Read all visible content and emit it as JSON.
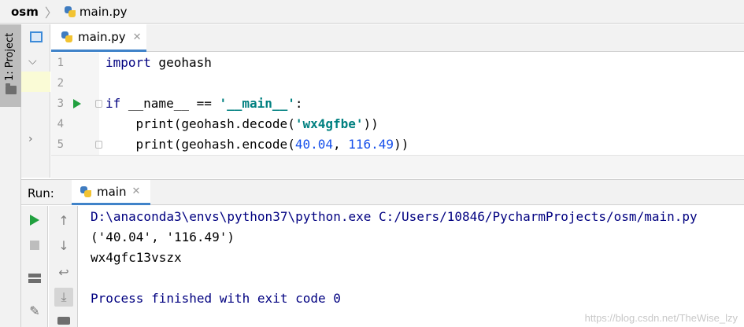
{
  "breadcrumb": {
    "project": "osm",
    "file": "main.py"
  },
  "left_strip": {
    "project_tab_label": "1: Project"
  },
  "editor": {
    "tab_label": "main.py",
    "lines": [
      {
        "num": "1",
        "parts": [
          {
            "t": "import",
            "c": "kw"
          },
          {
            "t": " geohash",
            "c": ""
          }
        ]
      },
      {
        "num": "2",
        "parts": []
      },
      {
        "num": "3",
        "parts": [
          {
            "t": "if",
            "c": "kw"
          },
          {
            "t": " __name__ == ",
            "c": ""
          },
          {
            "t": "'__main__'",
            "c": "str"
          },
          {
            "t": ":",
            "c": ""
          }
        ]
      },
      {
        "num": "4",
        "parts": [
          {
            "t": "    print(geohash.decode(",
            "c": ""
          },
          {
            "t": "'wx4gfbe'",
            "c": "str"
          },
          {
            "t": "))",
            "c": ""
          }
        ]
      },
      {
        "num": "5",
        "parts": [
          {
            "t": "    print(geohash.encode(",
            "c": ""
          },
          {
            "t": "40.04",
            "c": "num"
          },
          {
            "t": ", ",
            "c": ""
          },
          {
            "t": "116.49",
            "c": "num"
          },
          {
            "t": "))",
            "c": ""
          }
        ]
      }
    ]
  },
  "run": {
    "title": "Run:",
    "tab_label": "main",
    "console_lines": [
      {
        "text": "D:\\anaconda3\\envs\\python37\\python.exe C:/Users/10846/PycharmProjects/osm/main.py",
        "kind": "c-blue"
      },
      {
        "text": "('40.04', '116.49')",
        "kind": "c-out"
      },
      {
        "text": "wx4gfc13vszx",
        "kind": "c-out"
      },
      {
        "text": "",
        "kind": "c-out"
      },
      {
        "text": "Process finished with exit code 0",
        "kind": "c-blue"
      }
    ]
  },
  "watermark": "https://blog.csdn.net/TheWise_lzy",
  "colors": {
    "keyword": "#000080",
    "string": "#008080",
    "number": "#1750eb",
    "run_green": "#21a03f",
    "tab_accent": "#4083c9"
  }
}
